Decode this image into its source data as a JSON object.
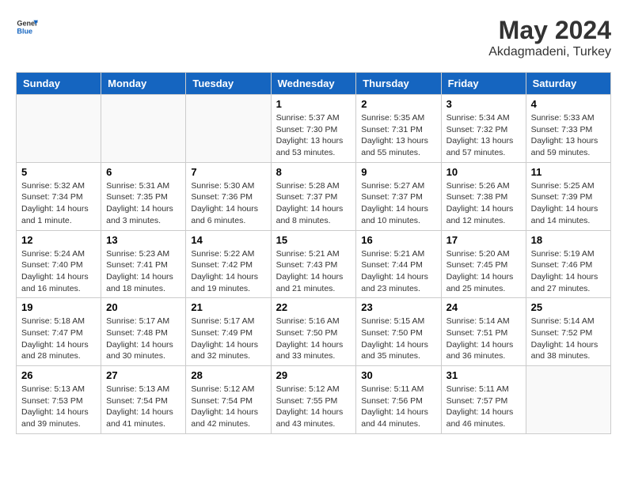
{
  "header": {
    "logo_general": "General",
    "logo_blue": "Blue",
    "title": "May 2024",
    "location": "Akdagmadeni, Turkey"
  },
  "days_of_week": [
    "Sunday",
    "Monday",
    "Tuesday",
    "Wednesday",
    "Thursday",
    "Friday",
    "Saturday"
  ],
  "weeks": [
    [
      {
        "day": "",
        "info": ""
      },
      {
        "day": "",
        "info": ""
      },
      {
        "day": "",
        "info": ""
      },
      {
        "day": "1",
        "info": "Sunrise: 5:37 AM\nSunset: 7:30 PM\nDaylight: 13 hours\nand 53 minutes."
      },
      {
        "day": "2",
        "info": "Sunrise: 5:35 AM\nSunset: 7:31 PM\nDaylight: 13 hours\nand 55 minutes."
      },
      {
        "day": "3",
        "info": "Sunrise: 5:34 AM\nSunset: 7:32 PM\nDaylight: 13 hours\nand 57 minutes."
      },
      {
        "day": "4",
        "info": "Sunrise: 5:33 AM\nSunset: 7:33 PM\nDaylight: 13 hours\nand 59 minutes."
      }
    ],
    [
      {
        "day": "5",
        "info": "Sunrise: 5:32 AM\nSunset: 7:34 PM\nDaylight: 14 hours\nand 1 minute."
      },
      {
        "day": "6",
        "info": "Sunrise: 5:31 AM\nSunset: 7:35 PM\nDaylight: 14 hours\nand 3 minutes."
      },
      {
        "day": "7",
        "info": "Sunrise: 5:30 AM\nSunset: 7:36 PM\nDaylight: 14 hours\nand 6 minutes."
      },
      {
        "day": "8",
        "info": "Sunrise: 5:28 AM\nSunset: 7:37 PM\nDaylight: 14 hours\nand 8 minutes."
      },
      {
        "day": "9",
        "info": "Sunrise: 5:27 AM\nSunset: 7:37 PM\nDaylight: 14 hours\nand 10 minutes."
      },
      {
        "day": "10",
        "info": "Sunrise: 5:26 AM\nSunset: 7:38 PM\nDaylight: 14 hours\nand 12 minutes."
      },
      {
        "day": "11",
        "info": "Sunrise: 5:25 AM\nSunset: 7:39 PM\nDaylight: 14 hours\nand 14 minutes."
      }
    ],
    [
      {
        "day": "12",
        "info": "Sunrise: 5:24 AM\nSunset: 7:40 PM\nDaylight: 14 hours\nand 16 minutes."
      },
      {
        "day": "13",
        "info": "Sunrise: 5:23 AM\nSunset: 7:41 PM\nDaylight: 14 hours\nand 18 minutes."
      },
      {
        "day": "14",
        "info": "Sunrise: 5:22 AM\nSunset: 7:42 PM\nDaylight: 14 hours\nand 19 minutes."
      },
      {
        "day": "15",
        "info": "Sunrise: 5:21 AM\nSunset: 7:43 PM\nDaylight: 14 hours\nand 21 minutes."
      },
      {
        "day": "16",
        "info": "Sunrise: 5:21 AM\nSunset: 7:44 PM\nDaylight: 14 hours\nand 23 minutes."
      },
      {
        "day": "17",
        "info": "Sunrise: 5:20 AM\nSunset: 7:45 PM\nDaylight: 14 hours\nand 25 minutes."
      },
      {
        "day": "18",
        "info": "Sunrise: 5:19 AM\nSunset: 7:46 PM\nDaylight: 14 hours\nand 27 minutes."
      }
    ],
    [
      {
        "day": "19",
        "info": "Sunrise: 5:18 AM\nSunset: 7:47 PM\nDaylight: 14 hours\nand 28 minutes."
      },
      {
        "day": "20",
        "info": "Sunrise: 5:17 AM\nSunset: 7:48 PM\nDaylight: 14 hours\nand 30 minutes."
      },
      {
        "day": "21",
        "info": "Sunrise: 5:17 AM\nSunset: 7:49 PM\nDaylight: 14 hours\nand 32 minutes."
      },
      {
        "day": "22",
        "info": "Sunrise: 5:16 AM\nSunset: 7:50 PM\nDaylight: 14 hours\nand 33 minutes."
      },
      {
        "day": "23",
        "info": "Sunrise: 5:15 AM\nSunset: 7:50 PM\nDaylight: 14 hours\nand 35 minutes."
      },
      {
        "day": "24",
        "info": "Sunrise: 5:14 AM\nSunset: 7:51 PM\nDaylight: 14 hours\nand 36 minutes."
      },
      {
        "day": "25",
        "info": "Sunrise: 5:14 AM\nSunset: 7:52 PM\nDaylight: 14 hours\nand 38 minutes."
      }
    ],
    [
      {
        "day": "26",
        "info": "Sunrise: 5:13 AM\nSunset: 7:53 PM\nDaylight: 14 hours\nand 39 minutes."
      },
      {
        "day": "27",
        "info": "Sunrise: 5:13 AM\nSunset: 7:54 PM\nDaylight: 14 hours\nand 41 minutes."
      },
      {
        "day": "28",
        "info": "Sunrise: 5:12 AM\nSunset: 7:54 PM\nDaylight: 14 hours\nand 42 minutes."
      },
      {
        "day": "29",
        "info": "Sunrise: 5:12 AM\nSunset: 7:55 PM\nDaylight: 14 hours\nand 43 minutes."
      },
      {
        "day": "30",
        "info": "Sunrise: 5:11 AM\nSunset: 7:56 PM\nDaylight: 14 hours\nand 44 minutes."
      },
      {
        "day": "31",
        "info": "Sunrise: 5:11 AM\nSunset: 7:57 PM\nDaylight: 14 hours\nand 46 minutes."
      },
      {
        "day": "",
        "info": ""
      }
    ]
  ]
}
